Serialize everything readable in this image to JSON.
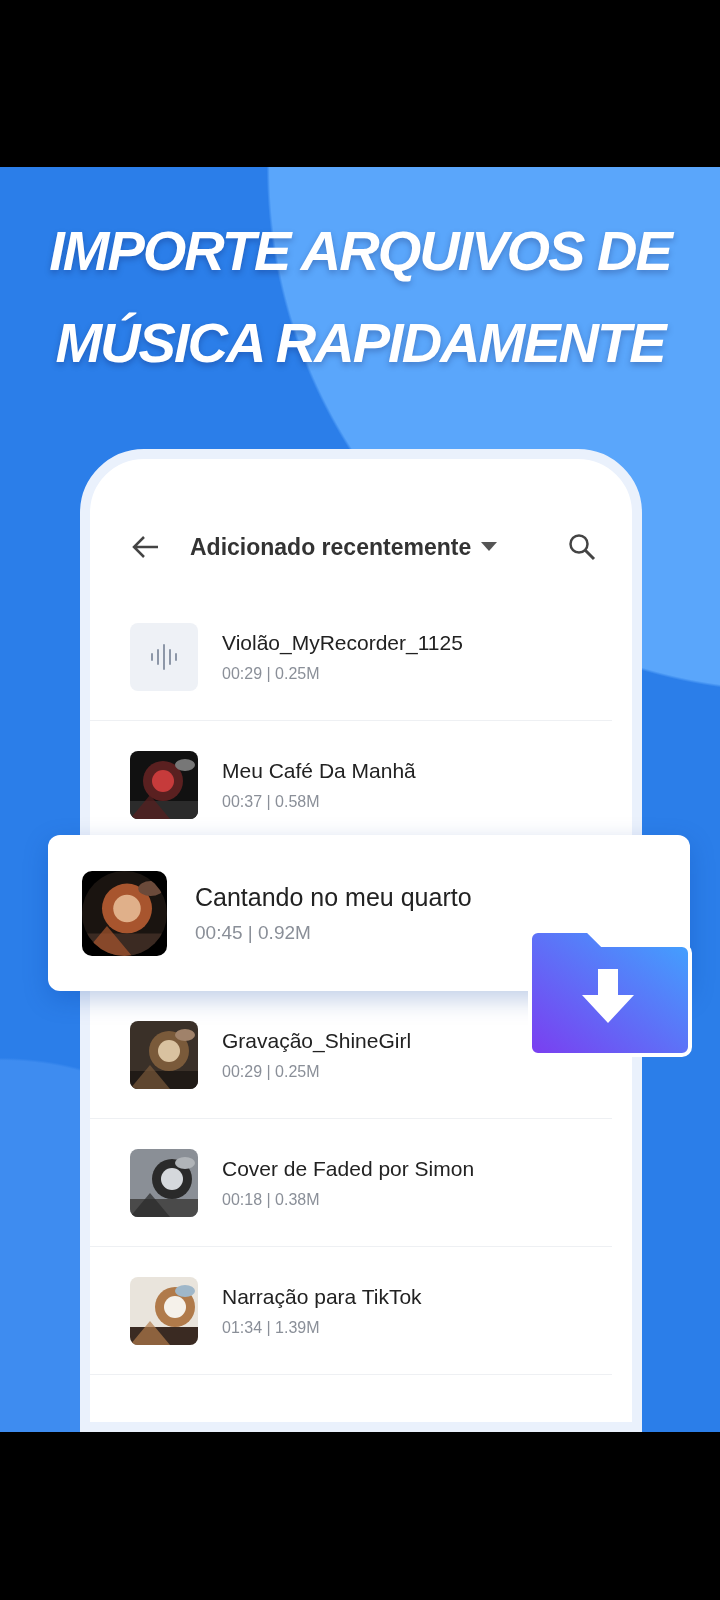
{
  "headline": [
    "IMPORTE ARQUIVOS DE",
    "MÚSICA RAPIDAMENTE"
  ],
  "header": {
    "title": "Adicionado recentemente"
  },
  "tracks": [
    {
      "kind": "recording",
      "title": "Violão_MyRecorder_1125",
      "meta": "00:29 | 0.25M",
      "highlighted": false
    },
    {
      "kind": "picture",
      "title": "Meu Café Da Manhã",
      "meta": "00:37 | 0.58M",
      "highlighted": false
    },
    {
      "kind": "picture",
      "title": "Cantando no meu quarto",
      "meta": "00:45 | 0.92M",
      "highlighted": true
    },
    {
      "kind": "picture",
      "title": "Gravação_ShineGirl",
      "meta": "00:29 | 0.25M",
      "highlighted": false
    },
    {
      "kind": "picture",
      "title": "Cover de Faded por Simon",
      "meta": "00:18 | 0.38M",
      "highlighted": false
    },
    {
      "kind": "picture",
      "title": "Narração para TikTok",
      "meta": "01:34 | 1.39M",
      "highlighted": false
    }
  ]
}
